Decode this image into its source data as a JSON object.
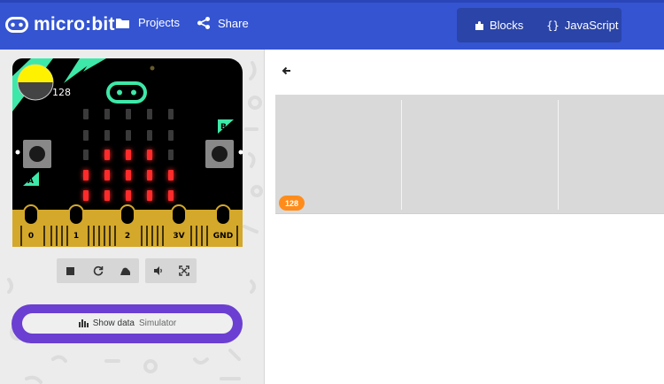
{
  "header": {
    "logo_text": "micro:bit",
    "projects_label": "Projects",
    "share_label": "Share",
    "blocks_label": "Blocks",
    "javascript_label": "JavaScript",
    "bg_color": "#3454d1"
  },
  "simulator": {
    "light_level": "128",
    "pins": [
      "0",
      "1",
      "2",
      "3V",
      "GND"
    ],
    "button_a": "A",
    "button_b": "B",
    "led_color": "#ff2b2b"
  },
  "controls": {
    "show_data_label": "Show data",
    "simulator_label": "Simulator"
  },
  "graph": {
    "value_badge": "128",
    "badge_color": "#ff8c1a"
  }
}
